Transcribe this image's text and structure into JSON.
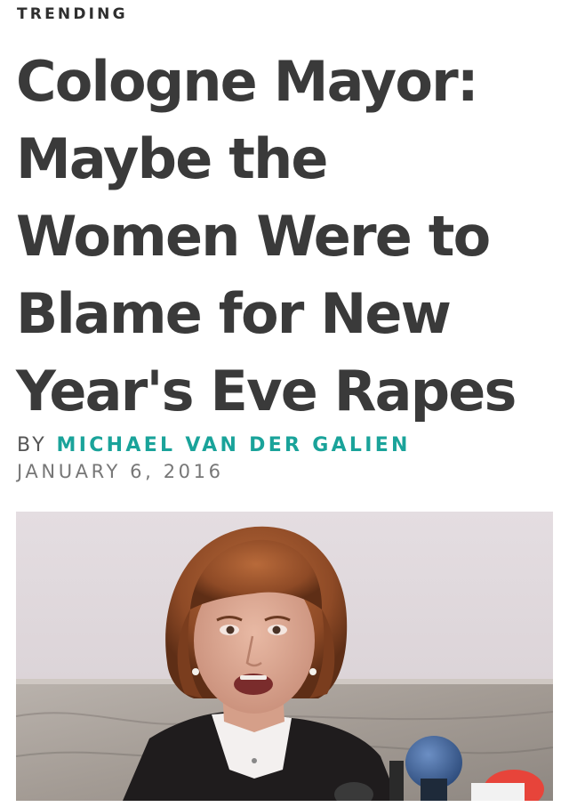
{
  "article": {
    "kicker": "TRENDING",
    "headline": "Cologne Mayor: Maybe the Women Were to Blame for New Year's Eve Rapes",
    "byline_prefix": "BY",
    "author": "MICHAEL VAN DER GALIEN",
    "date": "JANUARY 6, 2016"
  },
  "colors": {
    "headline": "#3a3a3a",
    "author": "#1aa39a",
    "meta": "#777777"
  }
}
